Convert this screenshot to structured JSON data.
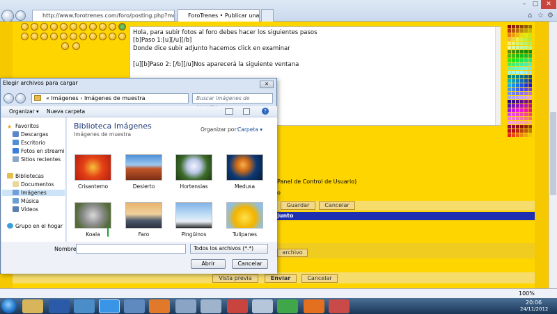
{
  "browser": {
    "url": "http://www.forotrenes.com/foro/posting.php?moc",
    "tab_title": "ForoTrenes • Publicar una r...",
    "zoom": "100%"
  },
  "editor": {
    "text": "Hola, para subir fotos al foro debes hacer los siguientes pasos\n[b]Paso 1:[u][/u][/b]\nDonde dice subir adjunto hacemos click en examinar\n\n[u][b]Paso 2: [/b][/u]Nos aparecerá la siguiente ventana"
  },
  "forum": {
    "ucp_text": "Panel de Control de Usuario)",
    "o_text": "o",
    "guardar": "Guardar",
    "cancelar": "Cancelar",
    "adjunto": "junto",
    "archivo": "archivo",
    "vista_previa": "Vista previa",
    "enviar": "Enviar",
    "cancelar2": "Cancelar"
  },
  "dialog": {
    "title": "Elegir archivos para cargar",
    "path": "« Imágenes › Imágenes de muestra",
    "search_placeholder": "Buscar Imágenes de muestra",
    "organize": "Organizar ▾",
    "new_folder": "Nueva carpeta",
    "library_title": "Biblioteca Imágenes",
    "library_sub": "Imágenes de muestra",
    "organize_by_label": "Organizar por:",
    "organize_by_value": "Carpeta ▾",
    "nav": [
      "Favoritos",
      "Descargas",
      "Escritorio",
      "Fotos en streami",
      "Sitios recientes",
      "Bibliotecas",
      "Documentos",
      "Imágenes",
      "Música",
      "Vídeos",
      "Grupo en el hogar"
    ],
    "thumbs": [
      "Crisantemo",
      "Desierto",
      "Hortensias",
      "Medusa",
      "Koala",
      "Faro",
      "Pingüinos",
      "Tulipanes"
    ],
    "filename_label": "Nombre:",
    "filetype": "Todos los archivos (*.*)",
    "open": "Abrir",
    "cancel": "Cancelar"
  },
  "clock": {
    "time": "20:06",
    "date": "24/11/2012"
  },
  "colors": {
    "forum_yellow": "#ffd500",
    "band_blue": "#1f2fb2",
    "dialog_frame": "#d8e4f3"
  }
}
